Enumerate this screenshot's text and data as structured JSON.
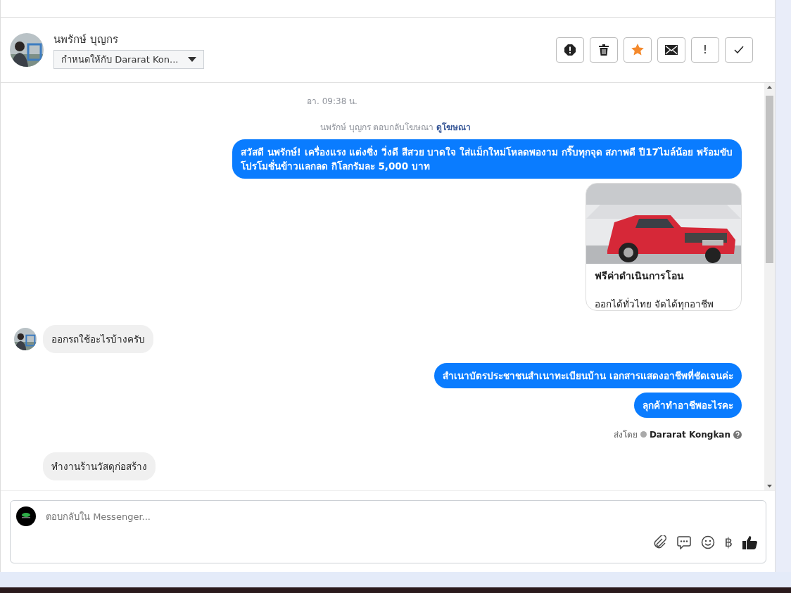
{
  "conversation_header": {
    "contact_name": "นพรักษ์ บุญกร",
    "assign_dropdown": "กำหนดให้กับ Dararat Kon...",
    "actions": [
      {
        "kind": "spam"
      },
      {
        "kind": "delete"
      },
      {
        "kind": "star",
        "on": true
      },
      {
        "kind": "mail"
      },
      {
        "kind": "text",
        "label": "!"
      },
      {
        "kind": "done"
      }
    ]
  },
  "messages": [
    {
      "kind": "timestamp",
      "text": "อา. 09:38 น."
    },
    {
      "kind": "notice",
      "text": "นพรักษ์ บุญกร ตอบกลับโฆษณา",
      "link": "ดูโฆษณา"
    },
    {
      "kind": "outgoing",
      "text": "สวัสดี นพรักษ์! เครื่องแรง แต่งซิ่ง วิ่งดี สีสวย บาดใจ ใส่แม็กใหม่โหลดพองาม กริ๊บทุกจุด สภาพดี ปี17ไมล์น้อย พร้อมขับ โปรโมชั่นข้าวแลกลด กิโลกรัมละ 5,000 บาท"
    },
    {
      "kind": "ad_card",
      "title": "ฟรีค่าดำเนินการโอน",
      "subtitle": "ออกได้ทั่วไทย จัดได้ทุกอาชีพ"
    },
    {
      "kind": "incoming",
      "text": "ออกรถใช้อะไรบ้างครับ",
      "show_avatar": true
    },
    {
      "kind": "outgoing",
      "text": "สำเนาบัตรประชาชนสำเนาทะเบียนบ้าน เอกสารแสดงอาชีพที่ชัดเจนค่ะ"
    },
    {
      "kind": "outgoing",
      "text": "ลุกค้าทำอาชีพอะไรคะ"
    },
    {
      "kind": "sender_note",
      "prefix": "ส่งโดย",
      "name": "Dararat Kongkan"
    },
    {
      "kind": "incoming",
      "text": "ทำงานร้านวัสดุก่อสร้าง",
      "show_avatar": false
    }
  ],
  "composer": {
    "placeholder": "ตอบกลับใน Messenger...",
    "tools": [
      {
        "kind": "attach"
      },
      {
        "kind": "quick_reply"
      },
      {
        "kind": "emoji"
      },
      {
        "kind": "text",
        "label": "฿"
      },
      {
        "kind": "like"
      }
    ]
  }
}
